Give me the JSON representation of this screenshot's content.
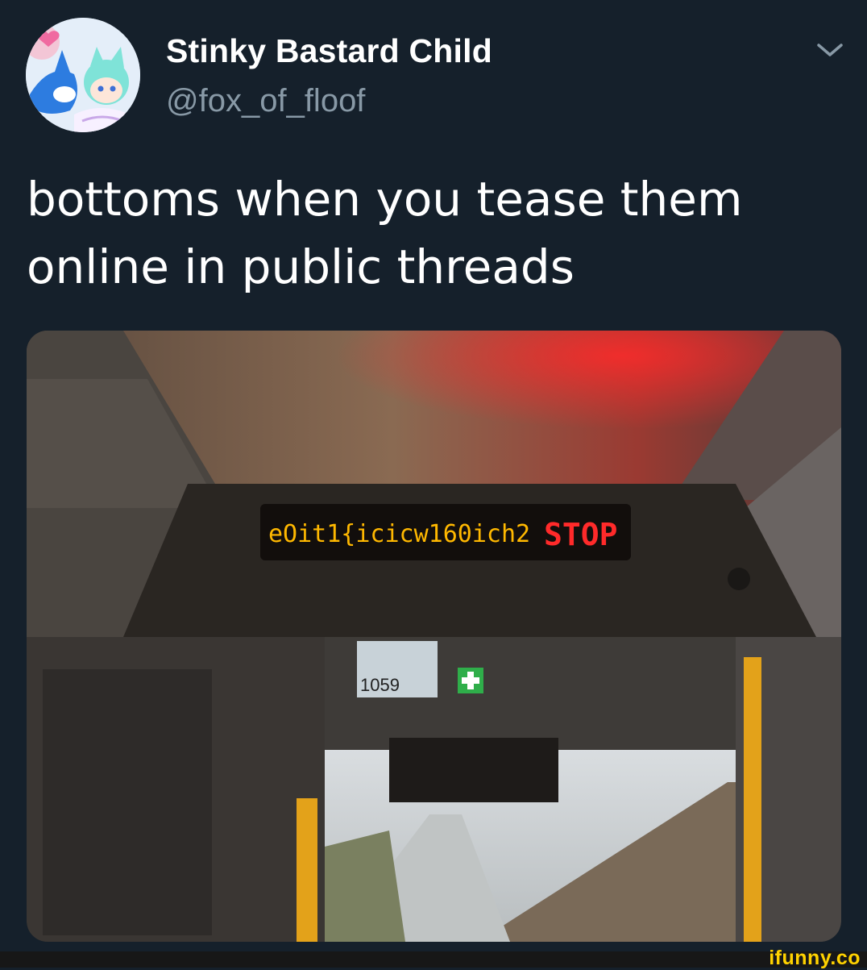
{
  "tweet": {
    "author": {
      "display_name": "Stinky Bastard Child",
      "handle": "@fox_of_floof",
      "avatar_icon": "avatar-cartoon-fox-icon"
    },
    "menu_icon": "chevron-down-icon",
    "text": "bottoms when you tease them\nonline in public threads",
    "media": {
      "sign_text": "eOit1{icicw160ich2",
      "stop_label": "STOP",
      "bus_number": "1059"
    }
  },
  "footer": {
    "watermark": "ifunny.co"
  },
  "colors": {
    "background": "#15202b",
    "handle_gray": "#8899a6",
    "led_yellow": "#ffb800",
    "led_red": "#ff2a2a",
    "watermark_yellow": "#ffd200"
  }
}
